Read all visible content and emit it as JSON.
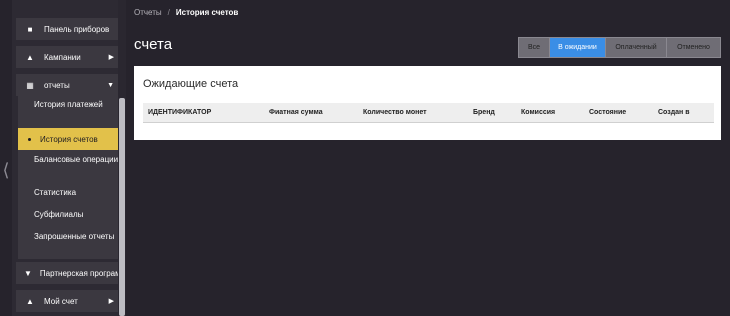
{
  "sidebar": {
    "dashboard_label": "Панель приборов",
    "campaigns_label": "Кампании",
    "reports_label": "отчеты",
    "sub": {
      "payment_history": "История платежей",
      "invoice_history": "История счетов",
      "balance_ops": "Балансовые операции",
      "stats": "Статистика",
      "subaffiliates": "Субфилиалы",
      "requested_reports": "Запрошенные отчеты"
    },
    "partner_program_label": "Партнерская программа",
    "my_account_label": "Мой счет"
  },
  "breadcrumb": {
    "parent": "Отчеты",
    "separator": "/",
    "current": "История счетов"
  },
  "page": {
    "title": "счета"
  },
  "filters": [
    "Все",
    "В ожидании",
    "Оплаченный",
    "Отменено"
  ],
  "card": {
    "title": "Ожидающие счета",
    "columns": [
      "ИДЕНТИФИКАТОР",
      "Фиатная сумма",
      "Количество монет",
      "Бренд",
      "Комиссия",
      "Состояние",
      "Создан в"
    ]
  },
  "icons": {
    "edge_handle": "chevron-left-icon"
  },
  "colors": {
    "accent_yellow": "#e2c14a",
    "accent_blue": "#3a8ee6"
  }
}
